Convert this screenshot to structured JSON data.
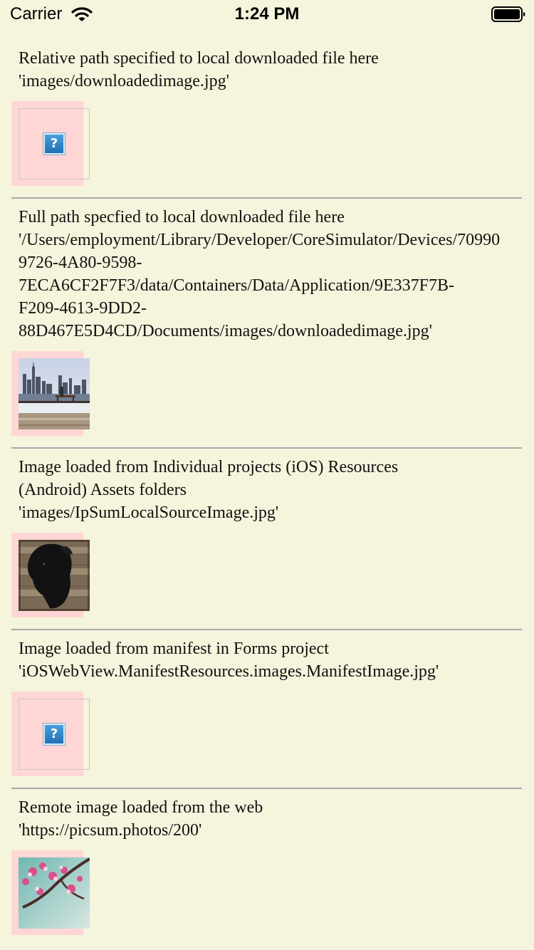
{
  "status_bar": {
    "carrier": "Carrier",
    "time": "1:24 PM",
    "wifi_icon": "wifi-icon",
    "battery_icon": "battery-icon"
  },
  "sections": [
    {
      "lines": [
        "Relative path specified to local downloaded file here",
        "'images/downloadedimage.jpg'"
      ],
      "image_state": "broken",
      "icon": "broken-image-icon",
      "icon_glyph": "?"
    },
    {
      "lines": [
        "Full path specfied to local downloaded file here",
        "'/Users/employment/Library/Developer/CoreSimulator/Devices/70990",
        "9726-4A80-9598-",
        "7ECA6CF2F7F3/data/Containers/Data/Application/9E337F7B-",
        "F209-4613-9DD2-",
        "88D467E5D4CD/Documents/images/downloadedimage.jpg'"
      ],
      "image_state": "loaded",
      "image_subject": "city-skyline-photo"
    },
    {
      "lines": [
        "Image loaded from Individual projects (iOS) Resources",
        "(Android) Assets folders",
        "'images/IpSumLocalSourceImage.jpg'"
      ],
      "image_state": "loaded",
      "image_subject": "black-dog-photo"
    },
    {
      "lines": [
        "Image loaded from manifest in Forms project",
        "'iOSWebView.ManifestResources.images.ManifestImage.jpg'"
      ],
      "image_state": "broken",
      "icon": "broken-image-icon",
      "icon_glyph": "?"
    },
    {
      "lines": [
        "Remote image loaded from the web",
        "'https://picsum.photos/200'"
      ],
      "image_state": "loaded",
      "image_subject": "cherry-blossom-photo"
    }
  ]
}
